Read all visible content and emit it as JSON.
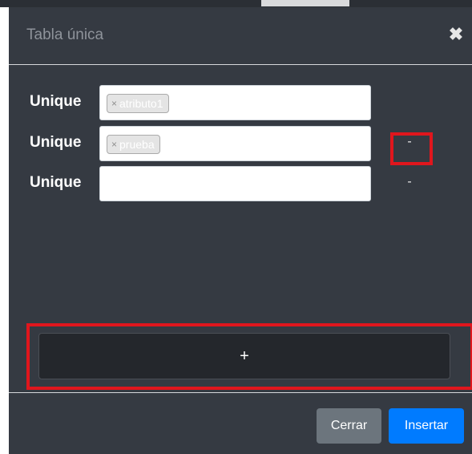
{
  "modal": {
    "title": "Tabla única",
    "close_icon": "close-icon"
  },
  "rows": [
    {
      "label": "Unique",
      "tags": [
        "atributo1"
      ],
      "remove_label": ""
    },
    {
      "label": "Unique",
      "tags": [
        "prueba"
      ],
      "remove_label": "-"
    },
    {
      "label": "Unique",
      "tags": [],
      "remove_label": "-"
    }
  ],
  "tag_remove_symbol": "×",
  "add_button": {
    "label": "+"
  },
  "footer": {
    "close_label": "Cerrar",
    "insert_label": "Insertar"
  },
  "colors": {
    "modal_bg": "#353a42",
    "highlight": "#e0161d",
    "primary": "#007bff",
    "secondary": "#6c757d"
  }
}
